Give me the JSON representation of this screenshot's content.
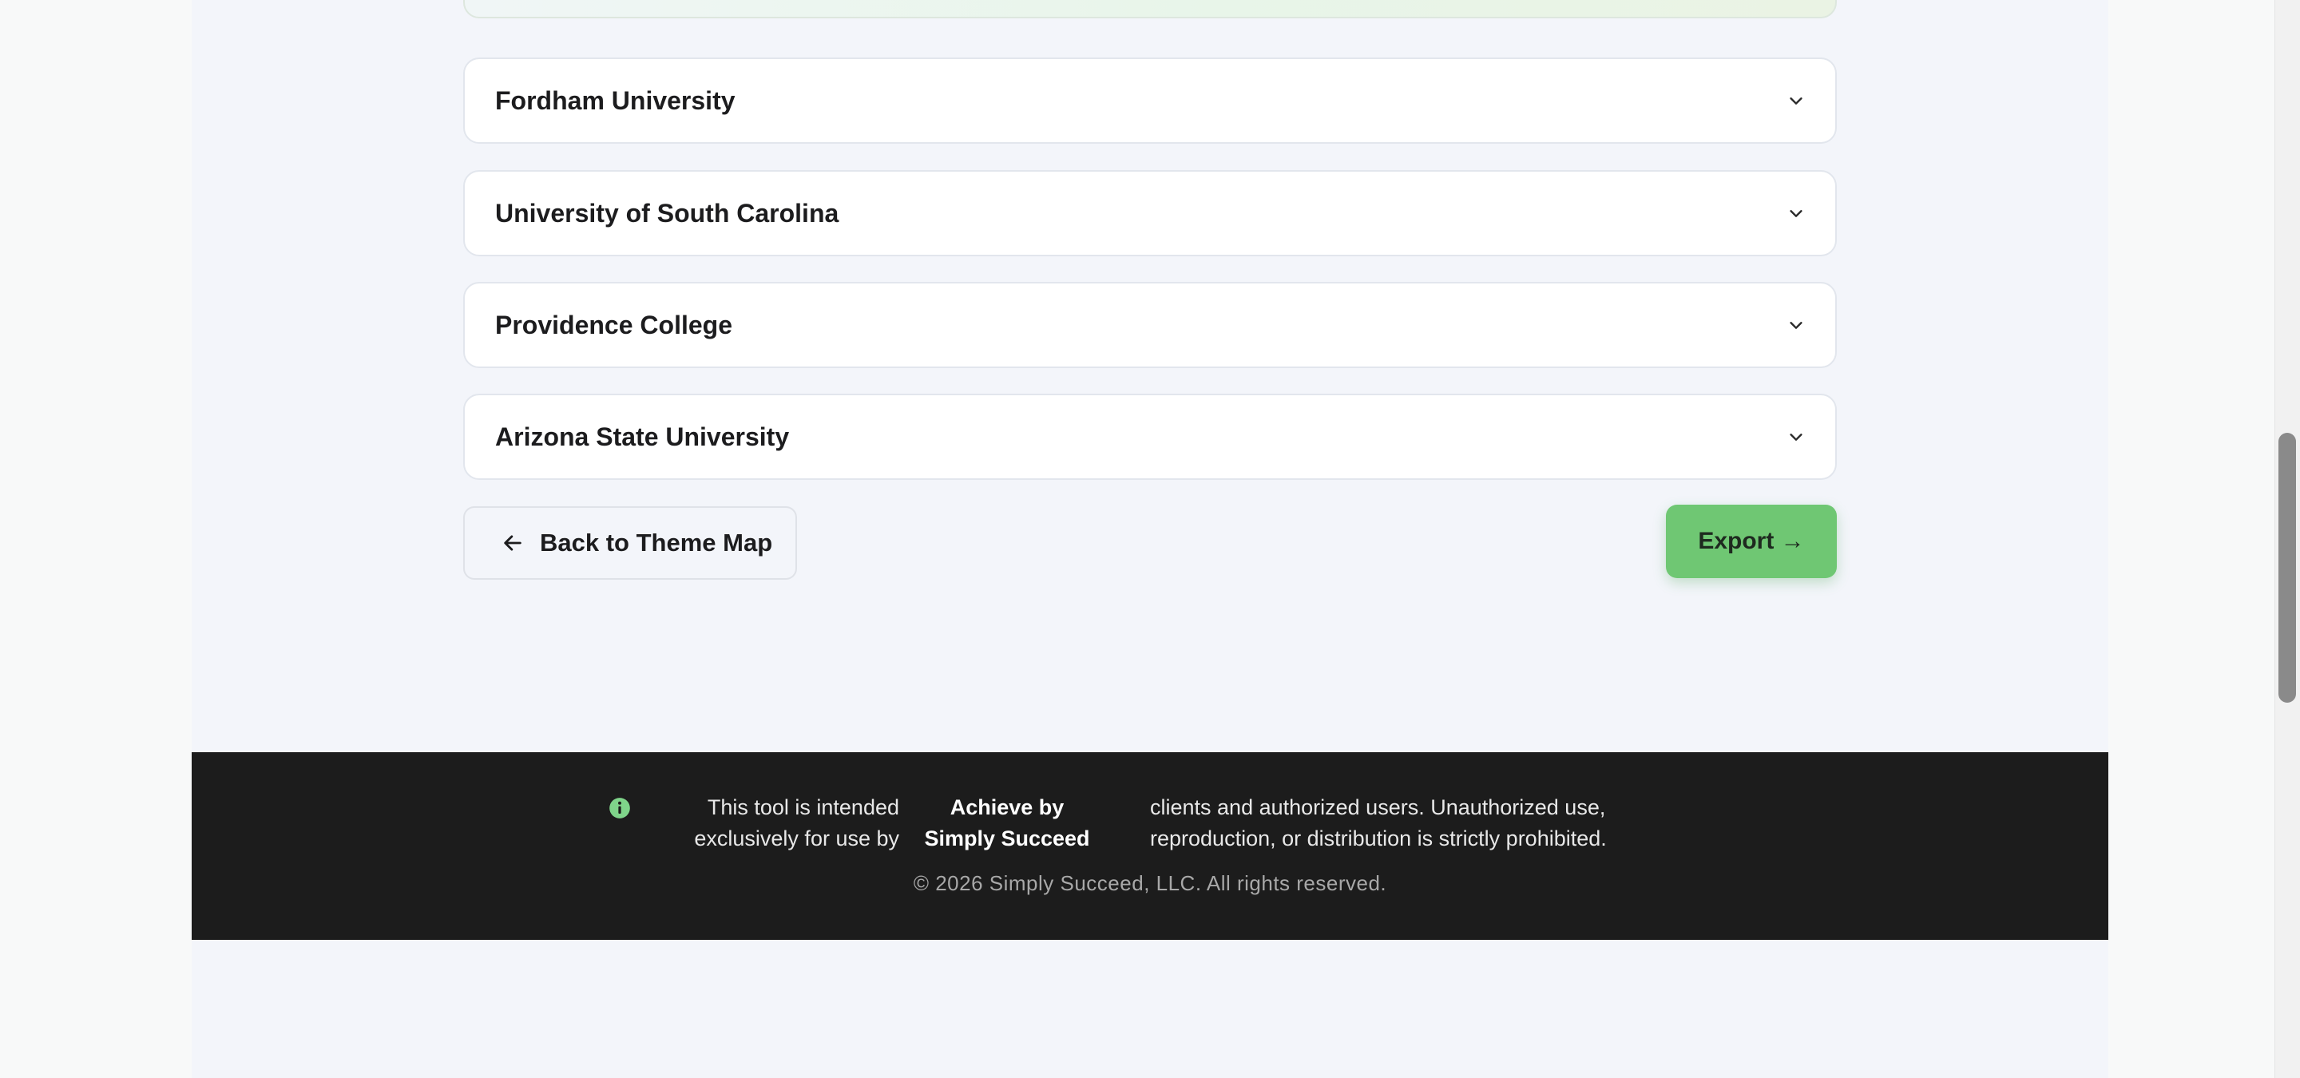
{
  "accordions": [
    {
      "title": "Fordham University"
    },
    {
      "title": "University of South Carolina"
    },
    {
      "title": "Providence College"
    },
    {
      "title": "Arizona State University"
    }
  ],
  "actions": {
    "back_label": "Back to Theme Map",
    "export_label": "Export →"
  },
  "footer": {
    "notice_part1": "This tool is intended exclusively for use by",
    "notice_brand": "Achieve by Simply Succeed",
    "notice_part2": "clients and authorized users. Unauthorized use, reproduction, or distribution is strictly prohibited.",
    "copyright": "© 2026 Simply Succeed, LLC. All rights reserved."
  },
  "colors": {
    "accent_green": "#6fc773",
    "footer_bg": "#1c1c1c",
    "page_bg": "#f3f5fa"
  },
  "icons": {
    "accordion_toggle": "chevron-down-icon",
    "back": "arrow-left-icon",
    "notice": "info-icon"
  }
}
